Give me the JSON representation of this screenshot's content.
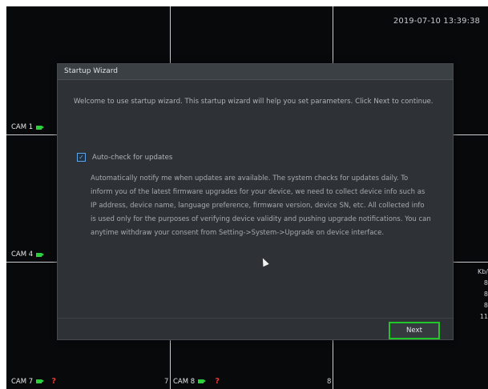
{
  "timestamp": "2019-07-10 13:39:38",
  "cameras": [
    {
      "label": "CAM 1"
    },
    {
      "label": "CAM 4"
    },
    {
      "label": "CAM 7",
      "channel_number": "7"
    },
    {
      "label": "CAM 8",
      "channel_number": "8"
    }
  ],
  "bitrate_panel": {
    "unit": "Kb/",
    "values": [
      "8",
      "8",
      "8",
      "11"
    ]
  },
  "wizard": {
    "title": "Startup Wizard",
    "intro": "Welcome to use startup wizard. This startup wizard will help you set parameters. Click Next to continue.",
    "auto_check_label": "Auto-check for updates",
    "auto_check_checked": true,
    "check_mark": "✓",
    "update_description": "Automatically notify me when updates are available. The system checks for updates daily. To inform you of the latest firmware upgrades for your device, we need to collect device info such as IP address, device name, language preference, firmware version, device SN, etc. All collected info is used only for the purposes of verifying device validity and pushing upgrade notifications. You can anytime withdraw your consent from Setting->System->Upgrade on device interface.",
    "next_label": "Next"
  },
  "icons": {
    "camera": "video-camera-icon",
    "alert": "?",
    "cursor": "mouse-cursor-icon"
  },
  "colors": {
    "accent_green": "#21c728",
    "checkbox_blue": "#5ea4e8",
    "alert_red": "#e53935"
  }
}
